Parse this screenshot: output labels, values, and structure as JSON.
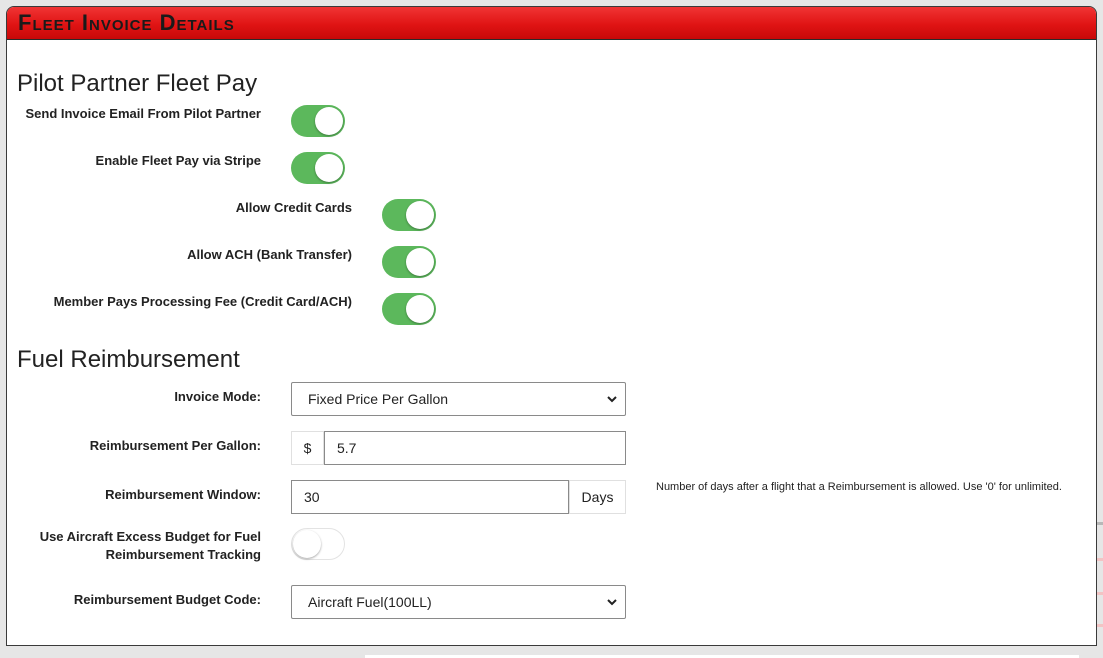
{
  "panel": {
    "title": "Fleet Invoice Details"
  },
  "fleet_pay": {
    "section_title": "Pilot Partner Fleet Pay",
    "toggles": [
      {
        "label": "Send Invoice Email From Pilot Partner",
        "state": "on"
      },
      {
        "label": "Enable Fleet Pay via Stripe",
        "state": "on"
      },
      {
        "label": "Allow Credit Cards",
        "state": "on"
      },
      {
        "label": "Allow ACH (Bank Transfer)",
        "state": "on"
      },
      {
        "label": "Member Pays Processing Fee (Credit Card/ACH)",
        "state": "on"
      }
    ]
  },
  "fuel": {
    "section_title": "Fuel Reimbursement",
    "invoice_mode": {
      "label": "Invoice Mode:",
      "value": "Fixed Price Per Gallon"
    },
    "per_gallon": {
      "label": "Reimbursement Per Gallon:",
      "prefix": "$",
      "value": "5.7"
    },
    "window": {
      "label": "Reimbursement Window:",
      "value": "30",
      "suffix": "Days",
      "help": "Number of days after a flight that a Reimbursement is allowed. Use '0' for unlimited."
    },
    "excess_budget": {
      "label_line1": "Use Aircraft Excess Budget for Fuel",
      "label_line2": "Reimbursement Tracking",
      "state": "off"
    },
    "budget_code": {
      "label": "Reimbursement Budget Code:",
      "value": "Aircraft Fuel(100LL)"
    }
  },
  "colors": {
    "header_red": "#e01414",
    "toggle_on": "#5cb85c"
  }
}
